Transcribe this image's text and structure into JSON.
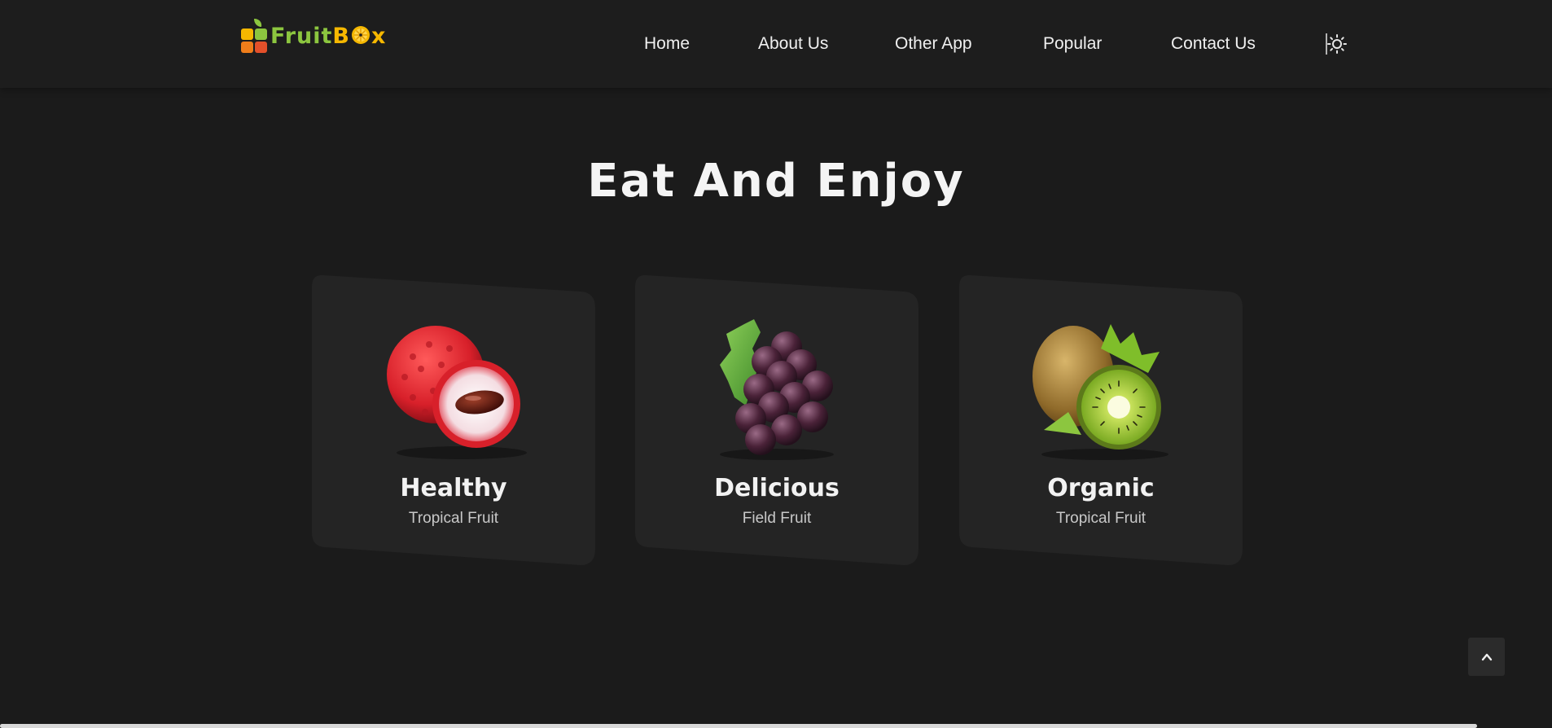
{
  "brand": {
    "logo_part1": "Fruit",
    "logo_part2": "B",
    "logo_part3": "x",
    "colors": {
      "green": "#8cc63f",
      "yellow": "#f6b800",
      "orange": "#ef7d1a"
    }
  },
  "nav": {
    "items": [
      {
        "label": "Home"
      },
      {
        "label": "About Us"
      },
      {
        "label": "Other App"
      },
      {
        "label": "Popular"
      },
      {
        "label": "Contact Us"
      }
    ],
    "theme_icon": "sun-icon"
  },
  "section": {
    "title": "Eat And Enjoy"
  },
  "cards": [
    {
      "name": "Healthy",
      "subtitle": "Tropical Fruit",
      "image": "lychee"
    },
    {
      "name": "Delicious",
      "subtitle": "Field Fruit",
      "image": "grapes"
    },
    {
      "name": "Organic",
      "subtitle": "Tropical Fruit",
      "image": "kiwi"
    }
  ],
  "scroll_top_icon": "chevron-up-icon",
  "colors": {
    "background": "#1b1b1b",
    "card": "#242424",
    "header": "#1d1d1d"
  }
}
